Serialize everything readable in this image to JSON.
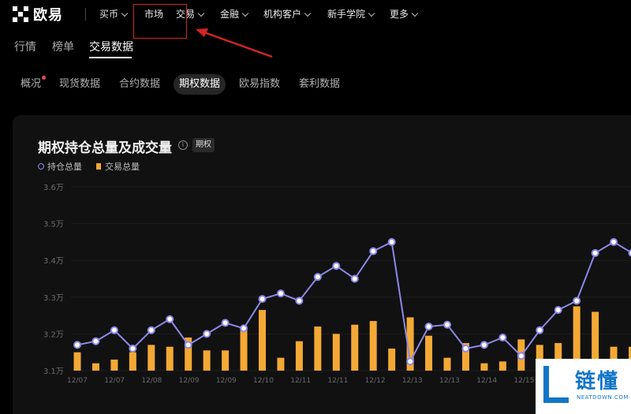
{
  "header": {
    "brand": "欧易",
    "nav": [
      {
        "label": "买币",
        "chevron": true
      },
      {
        "label": "市场",
        "chevron": false
      },
      {
        "label": "交易",
        "chevron": true
      },
      {
        "label": "金融",
        "chevron": true
      },
      {
        "label": "机构客户",
        "chevron": true
      },
      {
        "label": "新手学院",
        "chevron": true
      },
      {
        "label": "更多",
        "chevron": true
      }
    ]
  },
  "subnav": {
    "tabs": [
      "行情",
      "榜单",
      "交易数据"
    ],
    "active": "交易数据"
  },
  "pills": {
    "items": [
      "概况",
      "现货数据",
      "合约数据",
      "期权数据",
      "欧易指数",
      "套利数据"
    ],
    "active": "期权数据"
  },
  "chart_card": {
    "title": "期权持仓总量及成交量",
    "info_icon": "info-icon",
    "tag": "期权",
    "legend": {
      "line": "持仓总量",
      "bar": "交易总量"
    }
  },
  "annotation": {
    "color": "#d62424"
  },
  "colors": {
    "line": "#8d88e6",
    "bar": "#f4a935",
    "card": "#111112"
  },
  "watermark": {
    "cn": "链懂",
    "en": "NEATDOWN.COM"
  },
  "chart_data": {
    "type": "bar+line",
    "y_ticks": [
      "3.6万",
      "3.5万",
      "3.4万",
      "3.3万",
      "3.2万",
      "3.1万"
    ],
    "ylim": [
      31000,
      36000
    ],
    "x_labels": [
      "12/07",
      "12/07",
      "12/08",
      "12/09",
      "12/09",
      "12/10",
      "12/11",
      "12/11",
      "12/12",
      "12/13",
      "12/13",
      "12/14",
      "12/15"
    ],
    "series": [
      {
        "name": "持仓总量",
        "kind": "line",
        "values": [
          31700,
          31800,
          32100,
          31600,
          32100,
          32400,
          31700,
          32000,
          32300,
          32150,
          32950,
          33100,
          32900,
          33550,
          33850,
          33500,
          34250,
          34500,
          31250,
          32200,
          32250,
          31600,
          31700,
          31900,
          31400,
          32100,
          32650,
          32900,
          34200,
          34500,
          34200
        ]
      },
      {
        "name": "交易总量",
        "kind": "bar",
        "values": [
          31500,
          31200,
          31300,
          31500,
          31700,
          31650,
          31900,
          31550,
          31550,
          32100,
          32650,
          31350,
          31800,
          32200,
          32000,
          32250,
          32350,
          31600,
          32450,
          31950,
          31350,
          31750,
          31200,
          31250,
          31850,
          31700,
          31750,
          32750,
          32600,
          31650,
          31650
        ]
      }
    ]
  }
}
